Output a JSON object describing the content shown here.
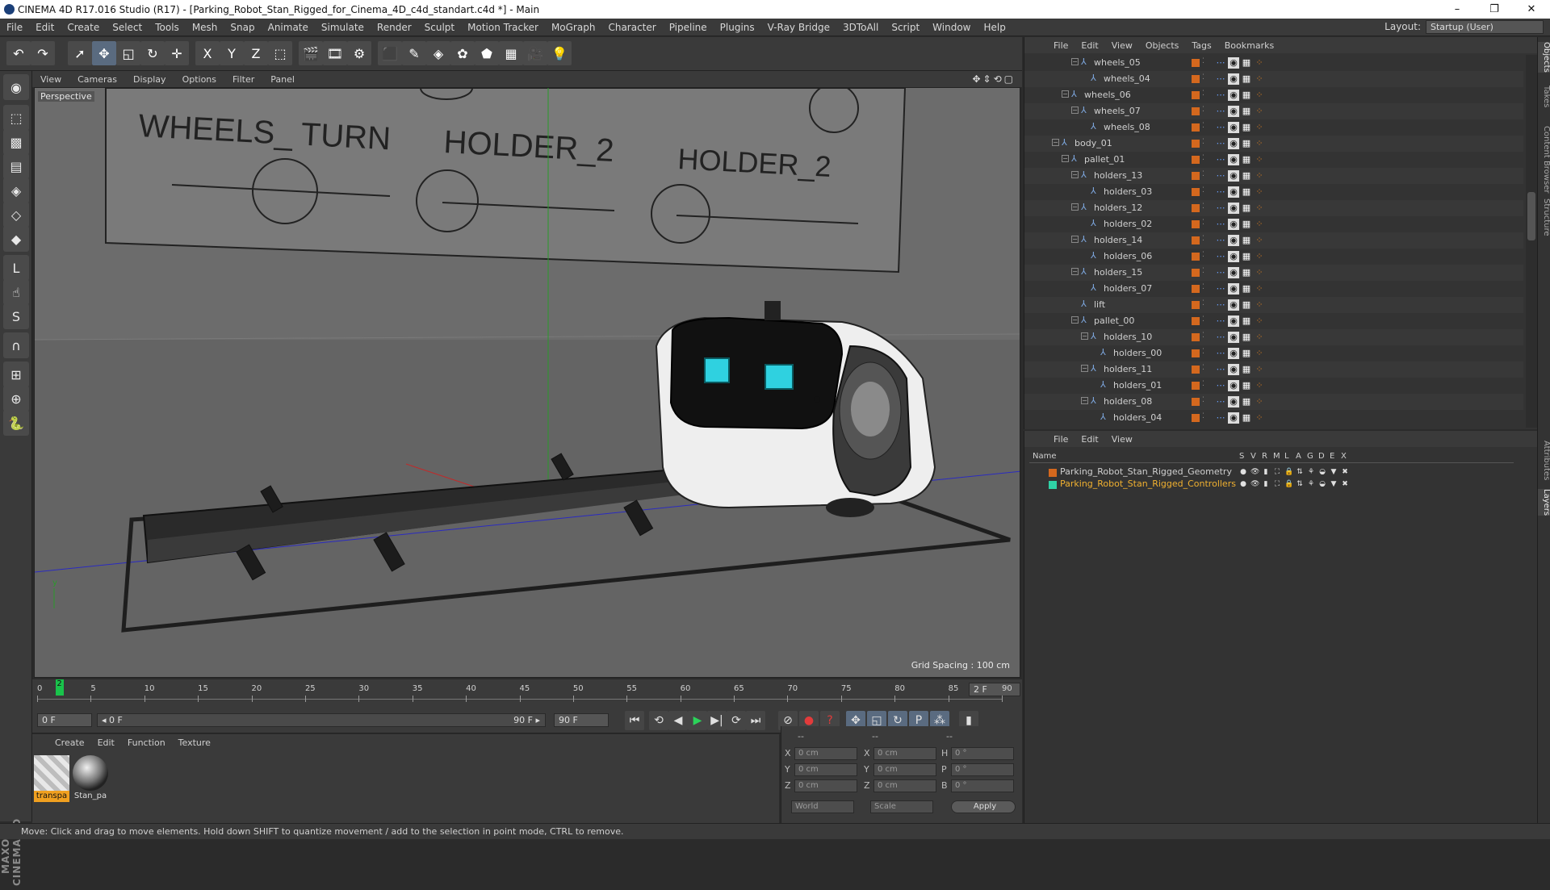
{
  "window": {
    "title": "CINEMA 4D R17.016 Studio (R17) - [Parking_Robot_Stan_Rigged_for_Cinema_4D_c4d_standart.c4d *] - Main",
    "minimize": "–",
    "maximize": "❐",
    "close": "✕"
  },
  "menubar": {
    "items": [
      "File",
      "Edit",
      "Create",
      "Select",
      "Tools",
      "Mesh",
      "Snap",
      "Animate",
      "Simulate",
      "Render",
      "Sculpt",
      "Motion Tracker",
      "MoGraph",
      "Character",
      "Pipeline",
      "Plugins",
      "V-Ray Bridge",
      "3DToAll",
      "Script",
      "Window",
      "Help"
    ],
    "layout_label": "Layout:",
    "layout_value": "Startup (User)"
  },
  "toolbar": {
    "icons": [
      "undo-icon",
      "redo-icon",
      "live-selection-icon",
      "move-icon",
      "scale-icon",
      "rotate-icon",
      "last-tool-icon",
      "x-axis-icon",
      "y-axis-icon",
      "z-axis-icon",
      "coordinate-system-icon",
      "render-view-icon",
      "render-picture-viewer-icon",
      "edit-render-settings-icon",
      "cube-icon",
      "pen-icon",
      "subdivision-icon",
      "cloner-icon",
      "deformer-icon",
      "floor-icon",
      "camera-icon",
      "light-icon"
    ],
    "glyphs": [
      "↶",
      "↷",
      "➚",
      "✥",
      "◱",
      "↻",
      "✛",
      "X",
      "Y",
      "Z",
      "⬚",
      "🎬",
      "🎞",
      "⚙",
      "⬛",
      "✎",
      "◈",
      "✿",
      "⬟",
      "▦",
      "🎥",
      "💡"
    ]
  },
  "lefttools": {
    "icons": [
      "make-editable-icon",
      "model-mode-icon",
      "texture-mode-icon",
      "workplane-icon",
      "points-mode-icon",
      "edges-mode-icon",
      "polygons-mode-icon",
      "axis-icon",
      "tweak-icon",
      "solo-icon",
      "magnet-icon",
      "snap-icon",
      "enable-snap-icon",
      "python-icon"
    ],
    "glyphs": [
      "◉",
      "⬚",
      "▩",
      "▤",
      "◈",
      "◇",
      "◆",
      "L",
      "☝",
      "S",
      "∩",
      "⊞",
      "⊕",
      "🐍"
    ],
    "brand": "MAXON CINEMA 4D"
  },
  "viewport_menu": {
    "items": [
      "View",
      "Cameras",
      "Display",
      "Options",
      "Filter",
      "Panel"
    ],
    "icons": "✥⇕⟲▢"
  },
  "viewport": {
    "label": "Perspective",
    "grid_spacing": "Grid Spacing : 100 cm",
    "board_labels": [
      "WHEELS_ TURN",
      "HOLDER_2",
      "HOLDER_2"
    ],
    "axis_y": "y"
  },
  "timeline": {
    "ticks": [
      "0",
      "5",
      "10",
      "15",
      "20",
      "25",
      "30",
      "35",
      "40",
      "45",
      "50",
      "55",
      "60",
      "65",
      "70",
      "75",
      "80",
      "85",
      "90"
    ],
    "current_marker": "2",
    "current_frame": "2 F"
  },
  "playback": {
    "start_field": "0 F",
    "range_left": "◂ 0 F",
    "range_right": "90 F ▸",
    "end_field": "90 F",
    "buttons": [
      "go-to-start",
      "go-to-previous-key",
      "play-backwards",
      "play-forwards",
      "go-to-next-key",
      "go-to-end"
    ],
    "glyphs": [
      "⏮",
      "⟲",
      "◀",
      "▶",
      "▶|",
      "⟳",
      "⏭"
    ],
    "key_tools": [
      "autokey-icon",
      "record-icon",
      "keyframe-selection-icon",
      "position-key-icon",
      "scale-key-icon",
      "rotation-key-icon",
      "parameter-key-icon",
      "pla-key-icon",
      "timeline-icon"
    ],
    "key_glyphs": [
      "⊘",
      "●",
      "?",
      "✥",
      "◱",
      "↻",
      "P",
      "⁂",
      "▮"
    ]
  },
  "materials": {
    "menu": [
      "Create",
      "Edit",
      "Function",
      "Texture"
    ],
    "items": [
      {
        "label": "transpa",
        "selected": true
      },
      {
        "label": "Stan_pa",
        "selected": false
      }
    ]
  },
  "coordinates": {
    "headers": [
      "--",
      "--",
      "--"
    ],
    "rows": [
      {
        "l1": "X",
        "v1": "0 cm",
        "l2": "X",
        "v2": "0 cm",
        "l3": "H",
        "v3": "0 °"
      },
      {
        "l1": "Y",
        "v1": "0 cm",
        "l2": "Y",
        "v2": "0 cm",
        "l3": "P",
        "v3": "0 °"
      },
      {
        "l1": "Z",
        "v1": "0 cm",
        "l2": "Z",
        "v2": "0 cm",
        "l3": "B",
        "v3": "0 °"
      }
    ],
    "world": "World",
    "scale": "Scale",
    "apply": "Apply"
  },
  "status": "Move: Click and drag to move elements. Hold down SHIFT to quantize movement / add to the selection in point mode, CTRL to remove.",
  "objects_panel": {
    "menu": [
      "File",
      "Edit",
      "View",
      "Objects",
      "Tags",
      "Bookmarks"
    ],
    "rows": [
      {
        "name": "wheels_05",
        "depth": 3,
        "expand": "⊟"
      },
      {
        "name": "wheels_04",
        "depth": 4,
        "expand": ""
      },
      {
        "name": "wheels_06",
        "depth": 2,
        "expand": "⊟"
      },
      {
        "name": "wheels_07",
        "depth": 3,
        "expand": "⊟"
      },
      {
        "name": "wheels_08",
        "depth": 4,
        "expand": ""
      },
      {
        "name": "body_01",
        "depth": 1,
        "expand": "⊟"
      },
      {
        "name": "pallet_01",
        "depth": 2,
        "expand": "⊟"
      },
      {
        "name": "holders_13",
        "depth": 3,
        "expand": "⊟"
      },
      {
        "name": "holders_03",
        "depth": 4,
        "expand": ""
      },
      {
        "name": "holders_12",
        "depth": 3,
        "expand": "⊟"
      },
      {
        "name": "holders_02",
        "depth": 4,
        "expand": ""
      },
      {
        "name": "holders_14",
        "depth": 3,
        "expand": "⊟"
      },
      {
        "name": "holders_06",
        "depth": 4,
        "expand": ""
      },
      {
        "name": "holders_15",
        "depth": 3,
        "expand": "⊟"
      },
      {
        "name": "holders_07",
        "depth": 4,
        "expand": ""
      },
      {
        "name": "lift",
        "depth": 3,
        "expand": ""
      },
      {
        "name": "pallet_00",
        "depth": 3,
        "expand": "⊟"
      },
      {
        "name": "holders_10",
        "depth": 4,
        "expand": "⊟"
      },
      {
        "name": "holders_00",
        "depth": 5,
        "expand": ""
      },
      {
        "name": "holders_11",
        "depth": 4,
        "expand": "⊟"
      },
      {
        "name": "holders_01",
        "depth": 5,
        "expand": ""
      },
      {
        "name": "holders_08",
        "depth": 4,
        "expand": "⊟"
      },
      {
        "name": "holders_04",
        "depth": 5,
        "expand": ""
      }
    ]
  },
  "layers_panel": {
    "menu": [
      "File",
      "Edit",
      "View"
    ],
    "columns": [
      "Name",
      "S",
      "V",
      "R",
      "M",
      "L",
      "A",
      "G",
      "D",
      "E",
      "X"
    ],
    "rows": [
      {
        "name": "Parking_Robot_Stan_Rigged_Geometry",
        "color": "#d4681e",
        "text_color": "#cfcfcf"
      },
      {
        "name": "Parking_Robot_Stan_Rigged_Controllers",
        "color": "#2fd1a6",
        "text_color": "#f0b030"
      }
    ]
  },
  "side_tabs": [
    "Objects",
    "Takes",
    "Content Browser",
    "Structure",
    "Attributes",
    "Layers"
  ],
  "colors": {
    "accent": "#d4681e",
    "cyan": "#2fd1a6",
    "selected_text": "#f0b030",
    "viewport_bg": "#6d6d6d"
  }
}
